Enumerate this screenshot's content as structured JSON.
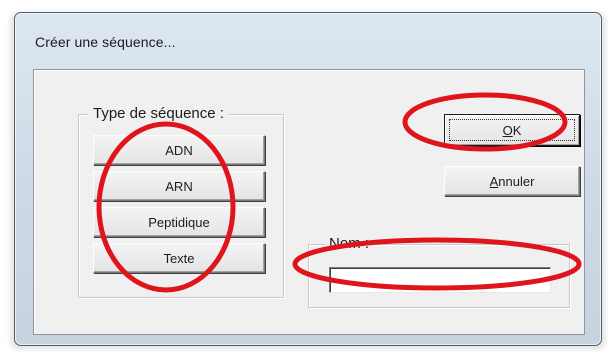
{
  "window": {
    "title": "Créer une séquence..."
  },
  "type_group": {
    "legend": "Type de séquence :",
    "buttons": [
      "ADN",
      "ARN",
      "Peptidique",
      "Texte"
    ]
  },
  "actions": {
    "ok_label": "OK",
    "cancel_label": "Annuler"
  },
  "name_group": {
    "legend": "Nom :",
    "value": ""
  },
  "annotation_color": "#e0141b"
}
